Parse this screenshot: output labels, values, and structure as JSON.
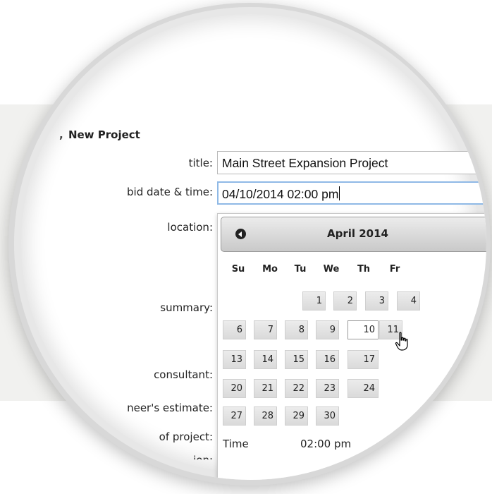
{
  "form": {
    "heading": "New Project",
    "heading_partial": ",",
    "labels": {
      "title": "title:",
      "bid_date": "bid date & time:",
      "location": "location:",
      "summary": "summary:",
      "consultant": "consultant:",
      "estimate": "neer's estimate:",
      "type": "of project:",
      "partial": "ion:"
    },
    "title_value": "Main Street Expansion Project",
    "bid_date_value": "04/10/2014 02:00 pm"
  },
  "calendar": {
    "month_label": "April 2014",
    "weekdays": [
      "Su",
      "Mo",
      "Tu",
      "We",
      "Th",
      "Fr"
    ],
    "weeks": [
      [
        "",
        "",
        "1",
        "2",
        "3",
        "4"
      ],
      [
        "6",
        "7",
        "8",
        "9",
        "10",
        "11"
      ],
      [
        "13",
        "14",
        "15",
        "16",
        "17",
        ""
      ],
      [
        "20",
        "21",
        "22",
        "23",
        "24",
        ""
      ],
      [
        "27",
        "28",
        "29",
        "30",
        "",
        ""
      ]
    ],
    "hovered_day": "10",
    "time_label": "Time",
    "time_value": "02:00 pm"
  },
  "icons": {
    "prev": "chevron-left-circle-icon",
    "cursor": "hand-pointer-icon"
  }
}
